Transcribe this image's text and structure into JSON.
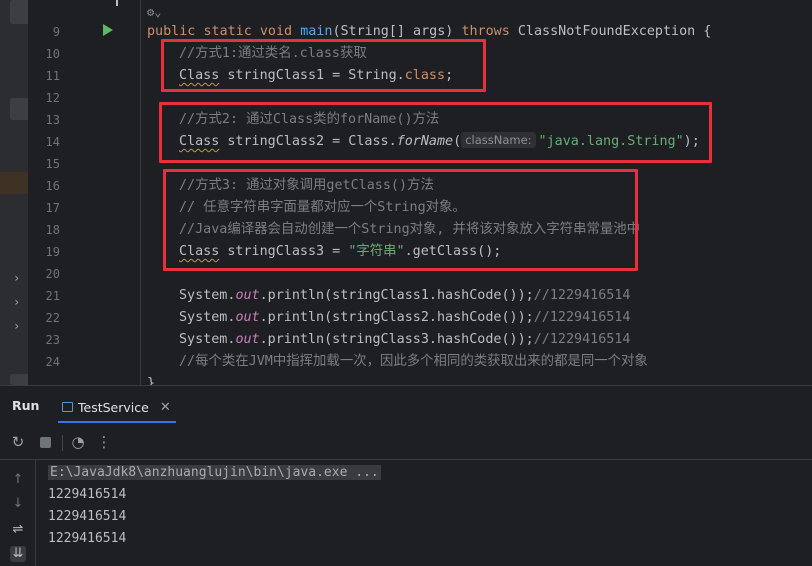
{
  "editor": {
    "line_numbers": [
      "9",
      "10",
      "11",
      "12",
      "13",
      "14",
      "15",
      "16",
      "17",
      "18",
      "19",
      "20",
      "21",
      "22",
      "23",
      "24"
    ],
    "ai_hint": "⚙︎⌄",
    "main_sig": {
      "kw1": "public",
      "kw2": "static",
      "kw3": "void",
      "name": "main",
      "args": "(String[] args) ",
      "kw4": "throws",
      "rest": " ClassNotFoundException {"
    },
    "l10_comment": "//方式1:通过类名.class获取",
    "l11": {
      "type": "Class",
      "decl": " stringClass1 = String.",
      "kw": "class",
      "end": ";"
    },
    "l13_comment": "//方式2: 通过Class类的forName()方法",
    "l14": {
      "type": "Class",
      "decl": " stringClass2 = Class.",
      "method": "forName",
      "open": "(",
      "hint": "className:",
      "str": "\"java.lang.String\"",
      "end": ");"
    },
    "l16_comment": "//方式3: 通过对象调用getClass()方法",
    "l17_comment": "// 任意字符串字面量都对应一个String对象。",
    "l18_comment": "//Java编译器会自动创建一个String对象, 并将该对象放入字符串常量池中",
    "l19": {
      "type": "Class",
      "decl": " stringClass3 = ",
      "str": "\"字符串\"",
      "end": ".getClass();"
    },
    "print_lines": [
      {
        "pre": "System.",
        "field": "out",
        "post": ".println(stringClass1.hashCode());",
        "cm": "//1229416514"
      },
      {
        "pre": "System.",
        "field": "out",
        "post": ".println(stringClass2.hashCode());",
        "cm": "//1229416514"
      },
      {
        "pre": "System.",
        "field": "out",
        "post": ".println(stringClass3.hashCode());",
        "cm": "//1229416514"
      }
    ],
    "l24_comment": "//每个类在JVM中指挥加载一次，因此多个相同的类获取出来的都是同一个对象",
    "closing_brace": "}"
  },
  "run_panel": {
    "title": "Run",
    "tab_label": "TestService",
    "tab_close": "✕",
    "console_lines": [
      "E:\\JavaJdk8\\anzhuanglujin\\bin\\java.exe ...",
      "1229416514",
      "1229416514",
      "1229416514"
    ]
  },
  "colors": {
    "highlight_box": "#e8303c",
    "accent": "#3574f0"
  }
}
